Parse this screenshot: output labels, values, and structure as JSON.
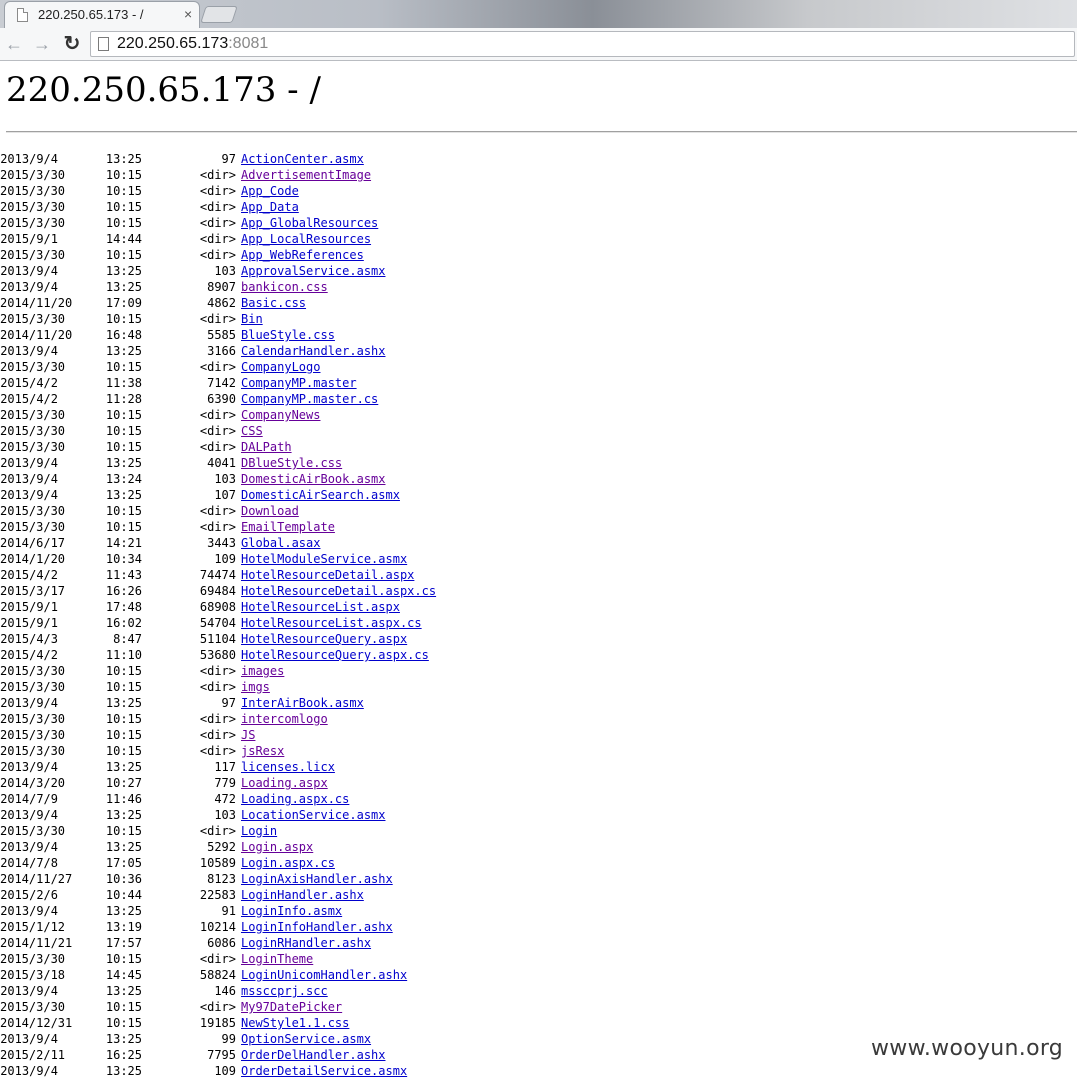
{
  "browser": {
    "tab_title": "220.250.65.173 - /",
    "tab_close": "×",
    "back_glyph": "←",
    "forward_glyph": "→",
    "reload_glyph": "↻",
    "url_host": "220.250.65.173",
    "url_port": ":8081"
  },
  "page": {
    "title": "220.250.65.173 - /"
  },
  "listing": {
    "rows": [
      {
        "date": "2013/9/4",
        "time": "13:25",
        "size": "97",
        "name": "ActionCenter.asmx",
        "visited": false
      },
      {
        "date": "2015/3/30",
        "time": "10:15",
        "size": "<dir>",
        "name": "AdvertisementImage",
        "visited": true
      },
      {
        "date": "2015/3/30",
        "time": "10:15",
        "size": "<dir>",
        "name": "App_Code",
        "visited": false
      },
      {
        "date": "2015/3/30",
        "time": "10:15",
        "size": "<dir>",
        "name": "App_Data",
        "visited": false
      },
      {
        "date": "2015/3/30",
        "time": "10:15",
        "size": "<dir>",
        "name": "App_GlobalResources",
        "visited": false
      },
      {
        "date": "2015/9/1",
        "time": "14:44",
        "size": "<dir>",
        "name": "App_LocalResources",
        "visited": false
      },
      {
        "date": "2015/3/30",
        "time": "10:15",
        "size": "<dir>",
        "name": "App_WebReferences",
        "visited": false
      },
      {
        "date": "2013/9/4",
        "time": "13:25",
        "size": "103",
        "name": "ApprovalService.asmx",
        "visited": false
      },
      {
        "date": "2013/9/4",
        "time": "13:25",
        "size": "8907",
        "name": "bankicon.css",
        "visited": true
      },
      {
        "date": "2014/11/20",
        "time": "17:09",
        "size": "4862",
        "name": "Basic.css",
        "visited": false
      },
      {
        "date": "2015/3/30",
        "time": "10:15",
        "size": "<dir>",
        "name": "Bin",
        "visited": false
      },
      {
        "date": "2014/11/20",
        "time": "16:48",
        "size": "5585",
        "name": "BlueStyle.css",
        "visited": false
      },
      {
        "date": "2013/9/4",
        "time": "13:25",
        "size": "3166",
        "name": "CalendarHandler.ashx",
        "visited": false
      },
      {
        "date": "2015/3/30",
        "time": "10:15",
        "size": "<dir>",
        "name": "CompanyLogo",
        "visited": false
      },
      {
        "date": "2015/4/2",
        "time": "11:38",
        "size": "7142",
        "name": "CompanyMP.master",
        "visited": false
      },
      {
        "date": "2015/4/2",
        "time": "11:28",
        "size": "6390",
        "name": "CompanyMP.master.cs",
        "visited": false
      },
      {
        "date": "2015/3/30",
        "time": "10:15",
        "size": "<dir>",
        "name": "CompanyNews",
        "visited": true
      },
      {
        "date": "2015/3/30",
        "time": "10:15",
        "size": "<dir>",
        "name": "CSS",
        "visited": true
      },
      {
        "date": "2015/3/30",
        "time": "10:15",
        "size": "<dir>",
        "name": "DALPath",
        "visited": true
      },
      {
        "date": "2013/9/4",
        "time": "13:25",
        "size": "4041",
        "name": "DBlueStyle.css",
        "visited": true
      },
      {
        "date": "2013/9/4",
        "time": "13:24",
        "size": "103",
        "name": "DomesticAirBook.asmx",
        "visited": true
      },
      {
        "date": "2013/9/4",
        "time": "13:25",
        "size": "107",
        "name": "DomesticAirSearch.asmx",
        "visited": false
      },
      {
        "date": "2015/3/30",
        "time": "10:15",
        "size": "<dir>",
        "name": "Download",
        "visited": true
      },
      {
        "date": "2015/3/30",
        "time": "10:15",
        "size": "<dir>",
        "name": "EmailTemplate",
        "visited": true
      },
      {
        "date": "2014/6/17",
        "time": "14:21",
        "size": "3443",
        "name": "Global.asax",
        "visited": false
      },
      {
        "date": "2014/1/20",
        "time": "10:34",
        "size": "109",
        "name": "HotelModuleService.asmx",
        "visited": false
      },
      {
        "date": "2015/4/2",
        "time": "11:43",
        "size": "74474",
        "name": "HotelResourceDetail.aspx",
        "visited": false
      },
      {
        "date": "2015/3/17",
        "time": "16:26",
        "size": "69484",
        "name": "HotelResourceDetail.aspx.cs",
        "visited": false
      },
      {
        "date": "2015/9/1",
        "time": "17:48",
        "size": "68908",
        "name": "HotelResourceList.aspx",
        "visited": false
      },
      {
        "date": "2015/9/1",
        "time": "16:02",
        "size": "54704",
        "name": "HotelResourceList.aspx.cs",
        "visited": false
      },
      {
        "date": "2015/4/3",
        "time": "8:47",
        "size": "51104",
        "name": "HotelResourceQuery.aspx",
        "visited": false
      },
      {
        "date": "2015/4/2",
        "time": "11:10",
        "size": "53680",
        "name": "HotelResourceQuery.aspx.cs",
        "visited": false
      },
      {
        "date": "2015/3/30",
        "time": "10:15",
        "size": "<dir>",
        "name": "images",
        "visited": true
      },
      {
        "date": "2015/3/30",
        "time": "10:15",
        "size": "<dir>",
        "name": "imgs",
        "visited": true
      },
      {
        "date": "2013/9/4",
        "time": "13:25",
        "size": "97",
        "name": "InterAirBook.asmx",
        "visited": false
      },
      {
        "date": "2015/3/30",
        "time": "10:15",
        "size": "<dir>",
        "name": "intercomlogo",
        "visited": true
      },
      {
        "date": "2015/3/30",
        "time": "10:15",
        "size": "<dir>",
        "name": "JS",
        "visited": true
      },
      {
        "date": "2015/3/30",
        "time": "10:15",
        "size": "<dir>",
        "name": "jsResx",
        "visited": true
      },
      {
        "date": "2013/9/4",
        "time": "13:25",
        "size": "117",
        "name": "licenses.licx",
        "visited": false
      },
      {
        "date": "2014/3/20",
        "time": "10:27",
        "size": "779",
        "name": "Loading.aspx",
        "visited": true
      },
      {
        "date": "2014/7/9",
        "time": "11:46",
        "size": "472",
        "name": "Loading.aspx.cs",
        "visited": false
      },
      {
        "date": "2013/9/4",
        "time": "13:25",
        "size": "103",
        "name": "LocationService.asmx",
        "visited": false
      },
      {
        "date": "2015/3/30",
        "time": "10:15",
        "size": "<dir>",
        "name": "Login",
        "visited": false
      },
      {
        "date": "2013/9/4",
        "time": "13:25",
        "size": "5292",
        "name": "Login.aspx",
        "visited": true
      },
      {
        "date": "2014/7/8",
        "time": "17:05",
        "size": "10589",
        "name": "Login.aspx.cs",
        "visited": false
      },
      {
        "date": "2014/11/27",
        "time": "10:36",
        "size": "8123",
        "name": "LoginAxisHandler.ashx",
        "visited": false
      },
      {
        "date": "2015/2/6",
        "time": "10:44",
        "size": "22583",
        "name": "LoginHandler.ashx",
        "visited": false
      },
      {
        "date": "2013/9/4",
        "time": "13:25",
        "size": "91",
        "name": "LoginInfo.asmx",
        "visited": false
      },
      {
        "date": "2015/1/12",
        "time": "13:19",
        "size": "10214",
        "name": "LoginInfoHandler.ashx",
        "visited": false
      },
      {
        "date": "2014/11/21",
        "time": "17:57",
        "size": "6086",
        "name": "LoginRHandler.ashx",
        "visited": false
      },
      {
        "date": "2015/3/30",
        "time": "10:15",
        "size": "<dir>",
        "name": "LoginTheme",
        "visited": true
      },
      {
        "date": "2015/3/18",
        "time": "14:45",
        "size": "58824",
        "name": "LoginUnicomHandler.ashx",
        "visited": false
      },
      {
        "date": "2013/9/4",
        "time": "13:25",
        "size": "146",
        "name": "mssccprj.scc",
        "visited": false
      },
      {
        "date": "2015/3/30",
        "time": "10:15",
        "size": "<dir>",
        "name": "My97DatePicker",
        "visited": true
      },
      {
        "date": "2014/12/31",
        "time": "10:15",
        "size": "19185",
        "name": "NewStyle1.1.css",
        "visited": false
      },
      {
        "date": "2013/9/4",
        "time": "13:25",
        "size": "99",
        "name": "OptionService.asmx",
        "visited": false
      },
      {
        "date": "2015/2/11",
        "time": "16:25",
        "size": "7795",
        "name": "OrderDelHandler.ashx",
        "visited": false
      },
      {
        "date": "2013/9/4",
        "time": "13:25",
        "size": "109",
        "name": "OrderDetailService.asmx",
        "visited": false
      }
    ]
  },
  "watermark": "www.wooyun.org"
}
